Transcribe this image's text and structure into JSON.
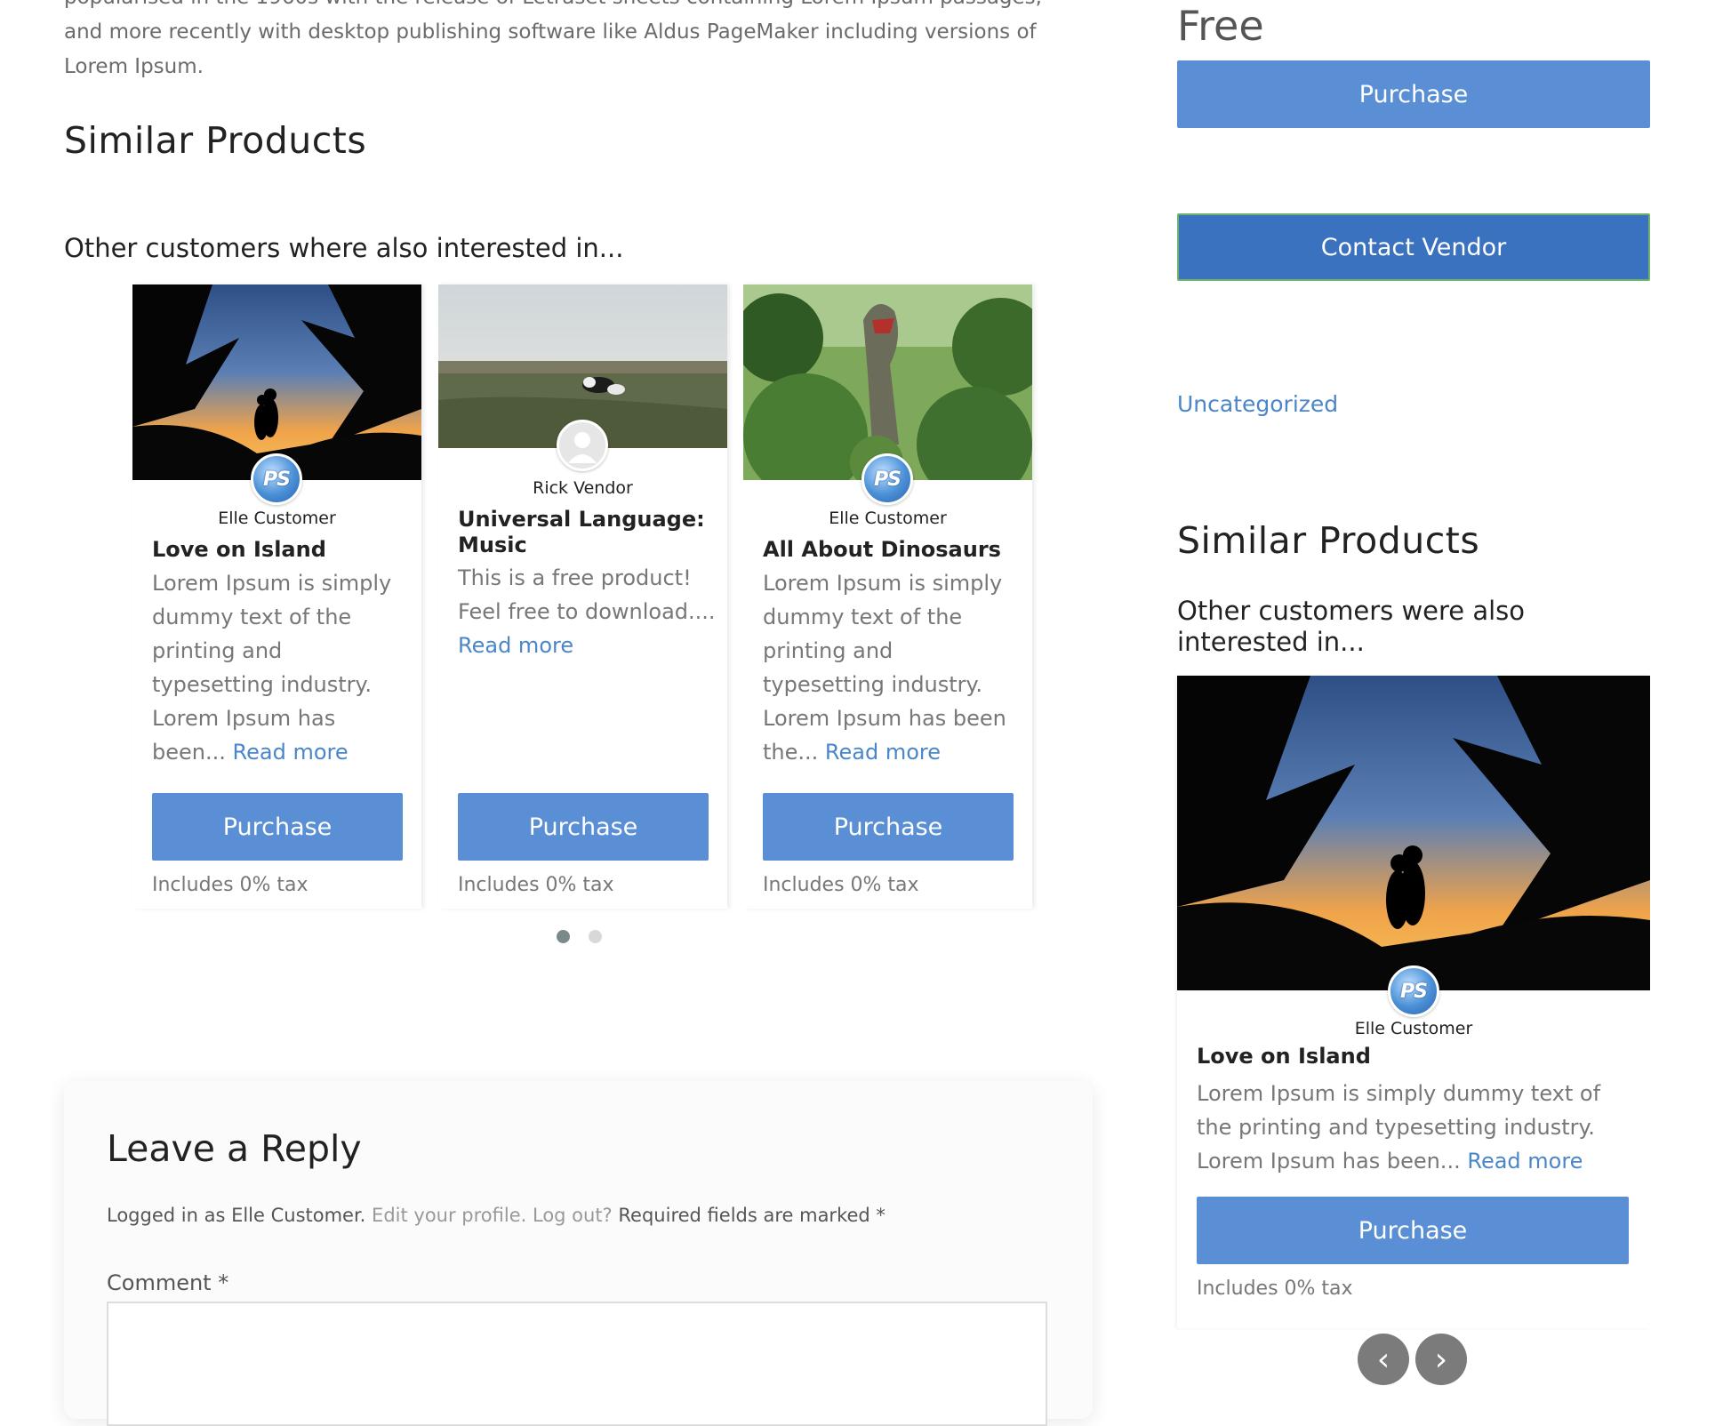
{
  "intro": {
    "lines": [
      "popularised in the 1960s with the release of Letraset sheets containing Lorem Ipsum passages,",
      "and more recently with desktop publishing software like Aldus PageMaker including versions of",
      "Lorem Ipsum."
    ]
  },
  "main": {
    "similar_heading": "Similar Products",
    "interested_heading": "Other customers where also interested in...",
    "cards": [
      {
        "vendor": "Elle Customer",
        "title": "Love on Island",
        "desc": "Lorem Ipsum is simply dummy text of the printing and typesetting industry. Lorem Ipsum has been...",
        "read_more": "Read more",
        "button": "Purchase",
        "tax": "Includes 0% tax"
      },
      {
        "vendor": "Rick Vendor",
        "title": "Universal Language: Music",
        "desc": "This is a free product! Feel free to download....",
        "read_more": "Read more",
        "button": "Purchase",
        "tax": "Includes 0% tax"
      },
      {
        "vendor": "Elle Customer",
        "title": "All About Dinosaurs",
        "desc": "Lorem Ipsum is simply dummy text of the printing and typesetting industry. Lorem Ipsum has been the...",
        "read_more": "Read more",
        "button": "Purchase",
        "tax": "Includes 0% tax"
      }
    ],
    "avatar_initials": "PS"
  },
  "reply": {
    "title": "Leave a Reply",
    "logged_in_prefix": "Logged in as Elle Customer.",
    "edit_profile": "Edit your profile.",
    "log_out": "Log out?",
    "required": "Required fields are marked *",
    "comment_label": "Comment *"
  },
  "sidebar": {
    "price": "Free",
    "purchase_button": "Purchase",
    "contact_button": "Contact Vendor",
    "category": "Uncategorized",
    "similar_heading": "Similar Products",
    "interested_heading": "Other customers were also interested in...",
    "card": {
      "vendor": "Elle Customer",
      "title": "Love on Island",
      "desc": "Lorem Ipsum is simply dummy text of the printing and typesetting industry. Lorem Ipsum has been...",
      "read_more": "Read more",
      "button": "Purchase",
      "tax": "Includes 0% tax"
    },
    "prev_icon": "chevron-left-icon",
    "next_icon": "chevron-right-icon"
  },
  "colors": {
    "button": "#5a8fd5",
    "contact_button": "#3a72bf",
    "link": "#4a86c8",
    "dot_active": "#7a8a8a",
    "dot_inactive": "#d8d8d8"
  }
}
